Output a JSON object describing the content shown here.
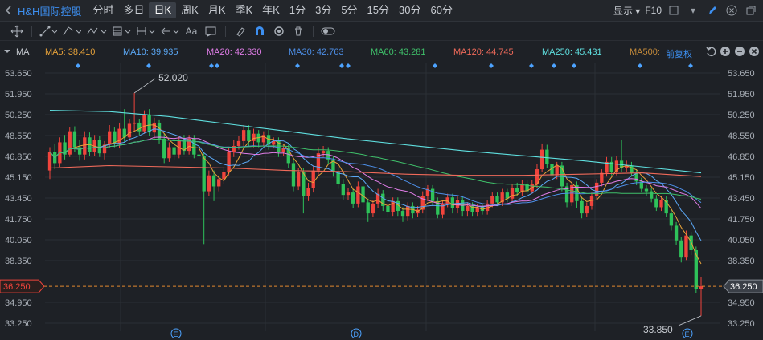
{
  "app": {
    "stock_title": "H&H国际控股",
    "periods": [
      "分时",
      "多日",
      "日K",
      "周K",
      "月K",
      "季K",
      "年K",
      "1分",
      "3分",
      "5分",
      "15分",
      "30分",
      "60分"
    ],
    "active_period": "日K",
    "display_label": "显示",
    "f10_label": "F10"
  },
  "toolbar": {
    "text_tool_label": "Aa"
  },
  "ma_bar": {
    "prefix": "MA",
    "ma5": "MA5: 38.410",
    "ma10": "MA10: 39.935",
    "ma20": "MA20: 42.330",
    "ma30": "MA30: 42.763",
    "ma60": "MA60: 43.281",
    "ma120": "MA120: 44.745",
    "ma250": "MA250: 45.431",
    "ma500": "MA500:",
    "adjust": "前复权"
  },
  "colors": {
    "ma5": "#e8a33a",
    "ma10": "#5ba8f5",
    "ma20": "#e07de8",
    "ma30": "#4d8fe8",
    "ma60": "#3fc06a",
    "ma120": "#f06a5a",
    "ma250": "#5fe0e0",
    "ma500": "#c48a3a",
    "up": "#f0443c",
    "down": "#2ec25a",
    "event_dot": "#4da3ff"
  },
  "chart_data": {
    "type": "candlestick",
    "y_ticks": [
      "53.650",
      "51.950",
      "50.250",
      "48.550",
      "46.850",
      "45.150",
      "43.450",
      "41.750",
      "40.050",
      "38.350",
      "34.950",
      "33.250"
    ],
    "ylim": [
      33.25,
      53.65
    ],
    "last_price": "36.250",
    "high_label": "52.020",
    "low_label": "33.850",
    "event_markers": [
      "E",
      "D",
      "E"
    ],
    "candles": [
      [
        45.7,
        47.2,
        45.0,
        47.6
      ],
      [
        47.2,
        46.3,
        45.8,
        47.9
      ],
      [
        46.3,
        48.0,
        46.0,
        48.4
      ],
      [
        48.0,
        47.0,
        46.6,
        48.6
      ],
      [
        47.0,
        48.9,
        46.8,
        49.2
      ],
      [
        48.9,
        47.6,
        47.2,
        49.3
      ],
      [
        47.6,
        47.0,
        46.5,
        48.2
      ],
      [
        47.0,
        48.4,
        46.6,
        48.9
      ],
      [
        48.4,
        47.2,
        46.9,
        48.8
      ],
      [
        47.2,
        48.2,
        46.9,
        48.6
      ],
      [
        48.2,
        47.1,
        46.8,
        48.5
      ],
      [
        47.1,
        47.8,
        46.6,
        48.1
      ],
      [
        47.8,
        48.9,
        47.5,
        49.4
      ],
      [
        48.9,
        47.9,
        47.6,
        49.2
      ],
      [
        47.9,
        49.1,
        47.5,
        49.6
      ],
      [
        49.1,
        48.4,
        48.0,
        50.7
      ],
      [
        48.4,
        49.5,
        48.1,
        49.9
      ],
      [
        49.5,
        49.6,
        48.9,
        52.02
      ],
      [
        49.6,
        48.9,
        48.6,
        49.9
      ],
      [
        48.9,
        50.2,
        48.7,
        50.6
      ],
      [
        50.2,
        48.8,
        48.5,
        50.7
      ],
      [
        48.8,
        49.6,
        48.3,
        50.0
      ],
      [
        49.6,
        48.3,
        47.9,
        49.8
      ],
      [
        48.3,
        46.7,
        46.3,
        48.7
      ],
      [
        46.7,
        47.6,
        46.4,
        48.0
      ],
      [
        47.6,
        47.0,
        46.6,
        48.2
      ],
      [
        47.0,
        48.2,
        46.7,
        48.5
      ],
      [
        48.2,
        47.3,
        47.0,
        48.6
      ],
      [
        47.3,
        48.3,
        47.0,
        48.6
      ],
      [
        48.3,
        47.0,
        46.7,
        48.6
      ],
      [
        47.0,
        46.9,
        46.5,
        47.3
      ],
      [
        46.9,
        44.0,
        39.7,
        47.2
      ],
      [
        44.0,
        45.3,
        43.6,
        45.7
      ],
      [
        45.3,
        44.4,
        43.2,
        45.7
      ],
      [
        44.4,
        45.0,
        44.0,
        45.3
      ],
      [
        45.0,
        45.6,
        44.6,
        46.0
      ],
      [
        45.6,
        47.2,
        45.3,
        47.6
      ],
      [
        47.2,
        47.7,
        46.8,
        48.2
      ],
      [
        47.7,
        48.1,
        47.4,
        48.5
      ],
      [
        48.1,
        49.0,
        47.7,
        49.4
      ],
      [
        49.0,
        48.1,
        47.7,
        49.4
      ],
      [
        48.1,
        48.7,
        47.6,
        49.1
      ],
      [
        48.7,
        48.0,
        47.6,
        49.0
      ],
      [
        48.0,
        48.6,
        47.7,
        48.9
      ],
      [
        48.6,
        47.8,
        47.4,
        49.0
      ],
      [
        47.8,
        48.1,
        47.5,
        48.4
      ],
      [
        48.1,
        47.2,
        46.8,
        48.4
      ],
      [
        47.2,
        47.5,
        46.9,
        47.8
      ],
      [
        47.5,
        46.3,
        45.9,
        47.8
      ],
      [
        46.3,
        44.4,
        44.0,
        46.6
      ],
      [
        44.4,
        45.6,
        44.1,
        45.9
      ],
      [
        45.6,
        43.6,
        42.2,
        45.9
      ],
      [
        43.6,
        44.3,
        43.2,
        44.7
      ],
      [
        44.3,
        45.7,
        43.9,
        46.1
      ],
      [
        45.7,
        47.1,
        45.3,
        47.6
      ],
      [
        47.1,
        47.3,
        46.8,
        47.7
      ],
      [
        47.3,
        46.6,
        46.2,
        47.6
      ],
      [
        46.6,
        45.6,
        45.2,
        46.9
      ],
      [
        45.6,
        44.6,
        44.2,
        46.0
      ],
      [
        44.6,
        43.7,
        43.3,
        45.0
      ],
      [
        43.7,
        43.9,
        43.3,
        44.3
      ],
      [
        43.9,
        43.0,
        42.6,
        44.2
      ],
      [
        43.0,
        44.4,
        42.7,
        44.8
      ],
      [
        44.4,
        43.1,
        42.4,
        44.7
      ],
      [
        43.1,
        42.2,
        41.5,
        43.4
      ],
      [
        42.2,
        43.0,
        41.9,
        43.3
      ],
      [
        43.0,
        43.8,
        42.6,
        44.2
      ],
      [
        43.8,
        42.8,
        42.4,
        44.1
      ],
      [
        42.8,
        42.3,
        41.9,
        43.1
      ],
      [
        42.3,
        43.2,
        42.0,
        43.5
      ],
      [
        43.2,
        42.4,
        42.0,
        43.5
      ],
      [
        42.4,
        42.0,
        41.5,
        42.7
      ],
      [
        42.0,
        42.8,
        41.6,
        43.1
      ],
      [
        42.8,
        42.2,
        41.8,
        43.1
      ],
      [
        42.2,
        42.5,
        41.9,
        42.8
      ],
      [
        42.5,
        43.6,
        42.2,
        44.0
      ],
      [
        43.6,
        44.2,
        43.2,
        44.5
      ],
      [
        44.2,
        43.2,
        42.8,
        44.5
      ],
      [
        43.2,
        42.1,
        41.8,
        43.5
      ],
      [
        42.1,
        43.0,
        41.8,
        43.3
      ],
      [
        43.0,
        43.5,
        42.7,
        43.8
      ],
      [
        43.5,
        42.6,
        42.2,
        43.8
      ],
      [
        42.6,
        43.3,
        42.2,
        43.6
      ],
      [
        43.3,
        42.4,
        42.0,
        43.6
      ],
      [
        42.4,
        42.8,
        42.0,
        43.1
      ],
      [
        42.8,
        42.3,
        42.0,
        43.1
      ],
      [
        42.3,
        42.7,
        42.0,
        43.0
      ],
      [
        42.7,
        42.4,
        42.1,
        43.0
      ],
      [
        42.4,
        43.0,
        42.1,
        43.3
      ],
      [
        43.0,
        43.6,
        42.7,
        43.9
      ],
      [
        43.6,
        43.1,
        42.8,
        43.9
      ],
      [
        43.1,
        43.9,
        42.8,
        44.2
      ],
      [
        43.9,
        43.4,
        43.1,
        44.2
      ],
      [
        43.4,
        44.3,
        43.1,
        44.6
      ],
      [
        44.3,
        43.9,
        43.6,
        44.7
      ],
      [
        43.9,
        44.6,
        43.6,
        44.9
      ],
      [
        44.6,
        44.0,
        43.7,
        44.9
      ],
      [
        44.0,
        44.6,
        43.8,
        44.9
      ],
      [
        44.6,
        45.8,
        44.3,
        46.2
      ],
      [
        45.8,
        47.4,
        45.6,
        47.9
      ],
      [
        47.4,
        46.2,
        45.9,
        47.8
      ],
      [
        46.2,
        45.3,
        44.9,
        46.5
      ],
      [
        45.3,
        46.1,
        45.0,
        46.4
      ],
      [
        46.1,
        44.4,
        44.0,
        46.4
      ],
      [
        44.4,
        43.1,
        42.7,
        44.7
      ],
      [
        43.1,
        44.5,
        42.8,
        44.8
      ],
      [
        44.5,
        43.2,
        42.6,
        44.8
      ],
      [
        43.2,
        42.2,
        41.8,
        43.5
      ],
      [
        42.2,
        42.8,
        41.9,
        43.1
      ],
      [
        42.8,
        43.6,
        42.5,
        43.9
      ],
      [
        43.6,
        44.7,
        43.3,
        45.0
      ],
      [
        44.7,
        45.5,
        44.4,
        45.8
      ],
      [
        45.5,
        46.4,
        45.2,
        46.8
      ],
      [
        46.4,
        45.6,
        45.3,
        46.8
      ],
      [
        45.6,
        46.5,
        45.3,
        46.9
      ],
      [
        46.5,
        45.9,
        45.6,
        48.2
      ],
      [
        45.9,
        46.1,
        45.6,
        46.5
      ],
      [
        46.1,
        45.5,
        45.2,
        46.4
      ],
      [
        45.5,
        44.8,
        44.5,
        45.8
      ],
      [
        44.8,
        44.2,
        43.9,
        45.1
      ],
      [
        44.2,
        44.0,
        43.6,
        44.5
      ],
      [
        44.0,
        43.4,
        43.1,
        44.3
      ],
      [
        43.4,
        42.7,
        42.4,
        43.7
      ],
      [
        42.7,
        43.3,
        42.4,
        43.6
      ],
      [
        43.3,
        42.2,
        41.9,
        43.6
      ],
      [
        42.2,
        41.2,
        40.8,
        42.5
      ],
      [
        41.2,
        40.0,
        39.6,
        41.5
      ],
      [
        40.0,
        38.6,
        38.2,
        40.3
      ],
      [
        38.6,
        40.4,
        38.4,
        40.8
      ],
      [
        40.4,
        39.2,
        38.8,
        40.7
      ],
      [
        39.2,
        36.0,
        35.7,
        39.5
      ],
      [
        36.0,
        36.25,
        33.85,
        37.0
      ]
    ]
  }
}
